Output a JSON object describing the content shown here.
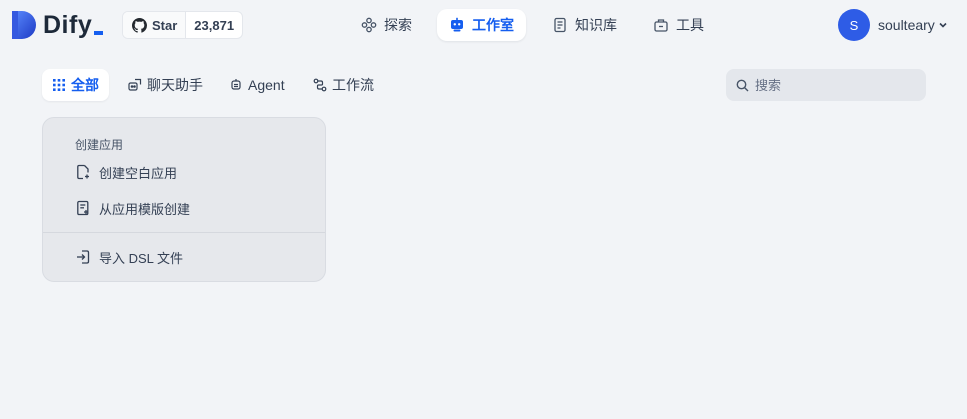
{
  "header": {
    "logo_text": "Dify",
    "github": {
      "star_label": "Star",
      "count": "23,871"
    },
    "nav": [
      {
        "label": "探索",
        "icon": "explore-icon"
      },
      {
        "label": "工作室",
        "icon": "robot-icon",
        "active": true
      },
      {
        "label": "知识库",
        "icon": "book-icon"
      },
      {
        "label": "工具",
        "icon": "toolbox-icon"
      }
    ],
    "user": {
      "avatar_letter": "S",
      "name": "soulteary"
    }
  },
  "tabs": [
    {
      "label": "全部",
      "icon": "grid-icon",
      "active": true
    },
    {
      "label": "聊天助手",
      "icon": "chat-bot-icon"
    },
    {
      "label": "Agent",
      "icon": "agent-icon"
    },
    {
      "label": "工作流",
      "icon": "workflow-icon"
    }
  ],
  "search": {
    "placeholder": "搜索"
  },
  "create_card": {
    "title": "创建应用",
    "items": [
      {
        "label": "创建空白应用",
        "icon": "file-plus-icon"
      },
      {
        "label": "从应用模版创建",
        "icon": "template-icon"
      },
      {
        "label": "导入 DSL 文件",
        "icon": "import-icon"
      }
    ]
  },
  "colors": {
    "accent": "#155eef",
    "avatar": "#2e5ce6",
    "background": "#f2f4f7"
  }
}
